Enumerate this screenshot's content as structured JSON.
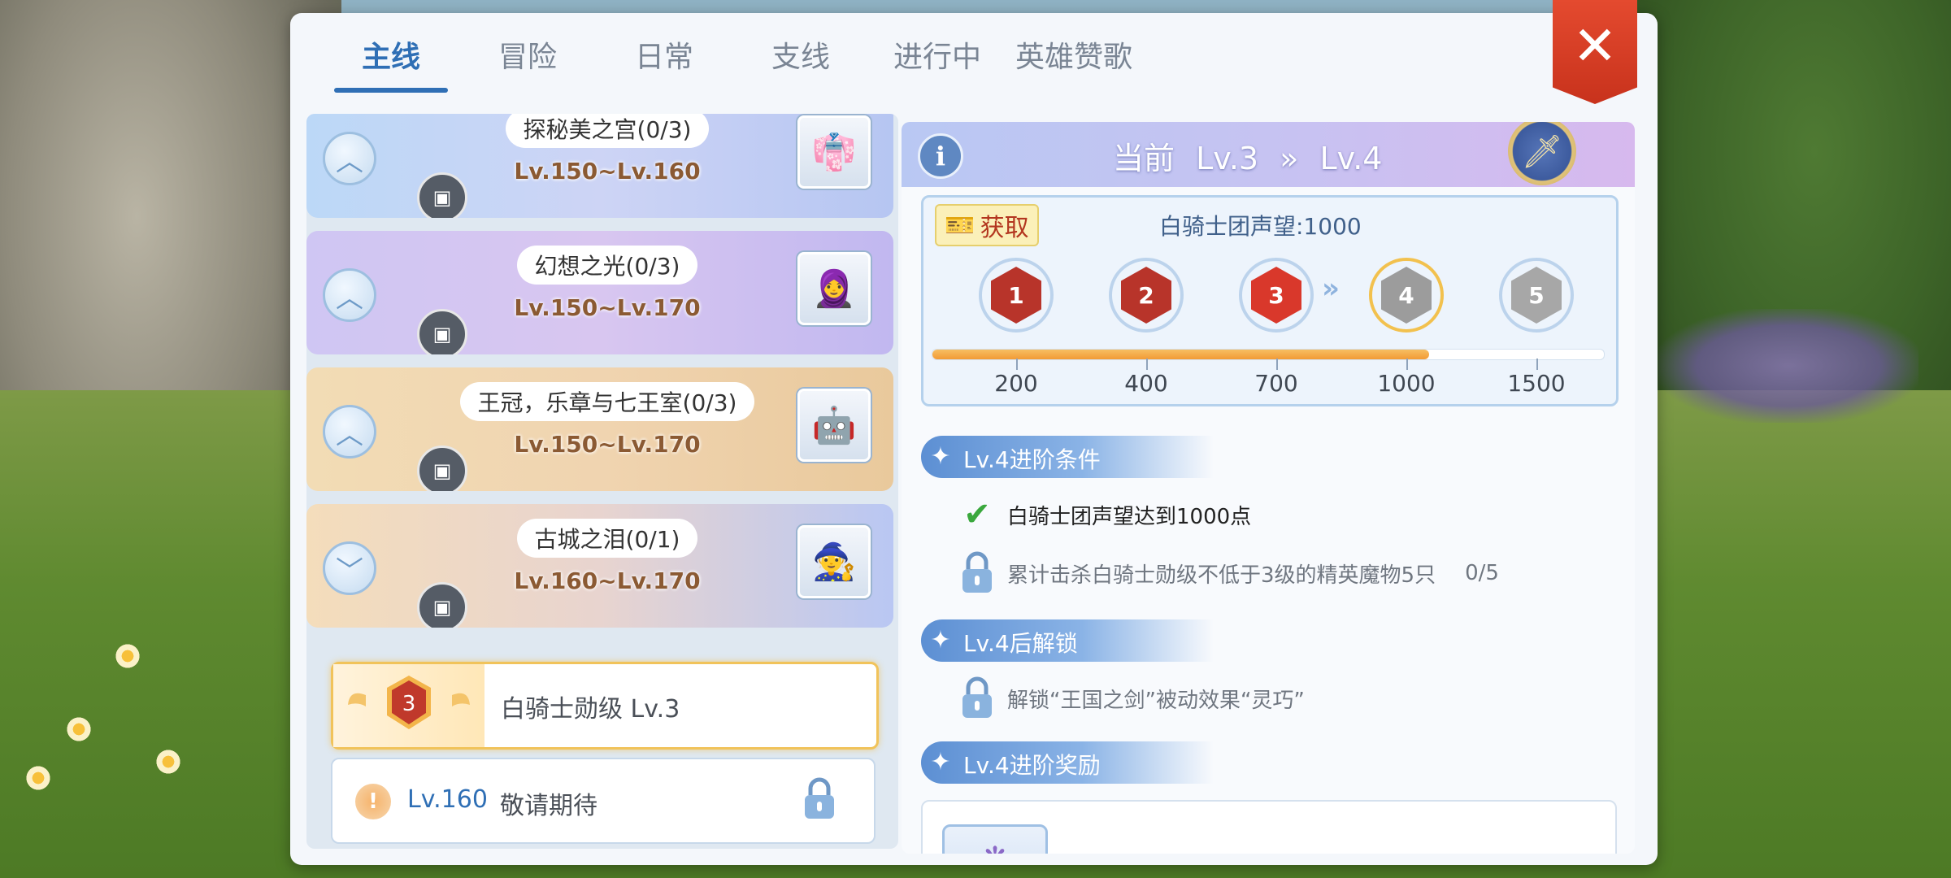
{
  "tabs": [
    {
      "label": "主线",
      "active": true
    },
    {
      "label": "冒险",
      "active": false
    },
    {
      "label": "日常",
      "active": false
    },
    {
      "label": "支线",
      "active": false
    },
    {
      "label": "进行中",
      "active": false
    },
    {
      "label": "英雄赞歌",
      "active": false
    }
  ],
  "close_button": "✕",
  "quests": [
    {
      "name": "探秘美之宫(0/3)",
      "level_range": "Lv.150~Lv.160",
      "theme": "blue",
      "expanded": true
    },
    {
      "name": "幻想之光(0/3)",
      "level_range": "Lv.150~Lv.170",
      "theme": "purple",
      "expanded": true
    },
    {
      "name": "王冠，乐章与七王室(0/3)",
      "level_range": "Lv.150~Lv.170",
      "theme": "gold",
      "expanded": true
    },
    {
      "name": "古城之泪(0/1)",
      "level_range": "Lv.160~Lv.170",
      "theme": "mix",
      "expanded": false
    }
  ],
  "rank_row": {
    "medal_number": "3",
    "label": "白骑士勋级 Lv.3"
  },
  "locked_row": {
    "level": "Lv.160",
    "label": "敬请期待"
  },
  "header": {
    "prefix": "当前",
    "from": "Lv.3",
    "arrow": "»",
    "to": "Lv.4"
  },
  "reputation": {
    "get_label": "获取",
    "label": "白骑士团声望:1000",
    "current": 1000,
    "max": 1500,
    "progress_fraction": 0.74,
    "medals": [
      {
        "number": "1",
        "threshold": "200",
        "state": "achieved",
        "color": "#b8342a"
      },
      {
        "number": "2",
        "threshold": "400",
        "state": "achieved",
        "color": "#b8342a"
      },
      {
        "number": "3",
        "threshold": "700",
        "state": "achieved",
        "color": "#d9382b"
      },
      {
        "number": "4",
        "threshold": "1000",
        "state": "next",
        "color": "#9c9c9c"
      },
      {
        "number": "5",
        "threshold": "1500",
        "state": "locked",
        "color": "#a7a7a7"
      }
    ]
  },
  "sections": {
    "conditions_title": "Lv.4进阶条件",
    "conditions": [
      {
        "text": "白骑士团声望达到1000点",
        "state": "done"
      },
      {
        "text": "累计击杀白骑士勋级不低于3级的精英魔物5只",
        "progress": "0/5",
        "state": "locked"
      }
    ],
    "unlock_title": "Lv.4后解锁",
    "unlocks": [
      {
        "text": "解锁“王国之剑”被动效果“灵巧”",
        "state": "locked"
      }
    ],
    "rewards_title": "Lv.4进阶奖励"
  },
  "colors": {
    "accent": "#2f6fb5",
    "close_red": "#d23a22",
    "progress_orange": "#f29a34",
    "check_green": "#3aa83d"
  },
  "icons": {
    "info": "info-icon",
    "close": "close-icon",
    "gallery": "gallery-icon",
    "lock": "lock-icon",
    "check": "check-icon"
  }
}
